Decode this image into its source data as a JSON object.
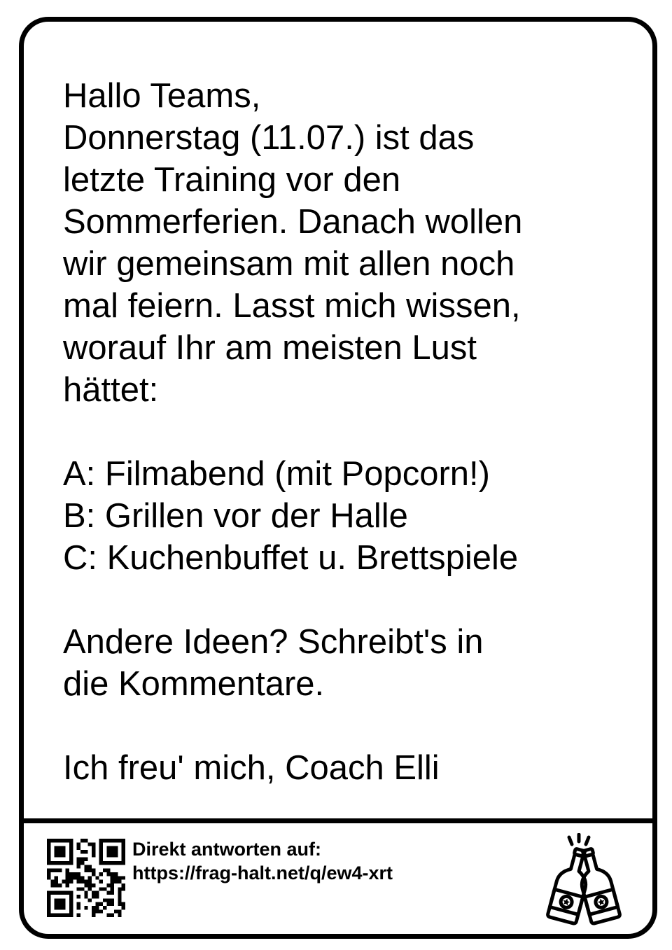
{
  "message": {
    "greeting": "Hallo Teams,",
    "body_lines": [
      "Donnerstag (11.07.) ist das",
      "letzte Training vor den",
      "Sommerferien. Danach wollen",
      "wir gemeinsam mit allen noch",
      "mal feiern. Lasst mich wissen,",
      "worauf Ihr am meisten Lust",
      "hättet:"
    ],
    "options": [
      "A: Filmabend (mit Popcorn!)",
      "B: Grillen vor der Halle",
      "C: Kuchenbuffet u. Brettspiele"
    ],
    "ideas_lines": [
      "Andere Ideen? Schreibt's in",
      "die Kommentare."
    ],
    "signoff": "Ich freu' mich, Coach Elli"
  },
  "footer": {
    "reply_label": "Direkt antworten auf:",
    "reply_url": "https://frag-halt.net/q/ew4-xrt",
    "qr_icon": "qr-code-icon",
    "bottles_icon": "clinking-bottles-icon"
  },
  "colors": {
    "ink": "#000000",
    "background": "#ffffff"
  }
}
